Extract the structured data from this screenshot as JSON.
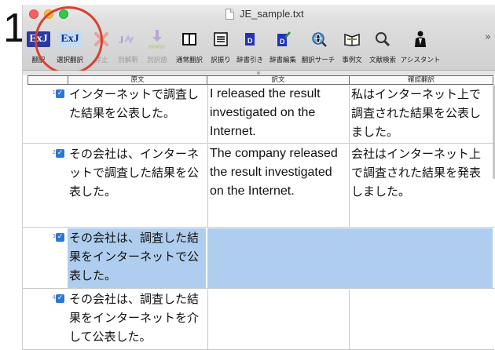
{
  "step_number": "1",
  "window": {
    "title": "JE_sample.txt"
  },
  "toolbar": {
    "items": [
      {
        "label": "翻訳",
        "icon": "exj-translate-icon"
      },
      {
        "label": "選択翻訳",
        "icon": "exj-selection-translate-icon"
      },
      {
        "label": "停止",
        "icon": "stop-x-icon"
      },
      {
        "label": "別解釈",
        "icon": "alternate-interpretation-icon"
      },
      {
        "label": "別訳語",
        "icon": "alternate-translation-word-icon"
      },
      {
        "label": "通常翻訳",
        "icon": "normal-translation-layout-icon"
      },
      {
        "label": "訳振り",
        "icon": "interlinear-translation-icon"
      },
      {
        "label": "辞書引き",
        "icon": "dictionary-lookup-icon"
      },
      {
        "label": "辞書編集",
        "icon": "dictionary-edit-icon"
      },
      {
        "label": "翻訳サーチ",
        "icon": "translation-search-icon"
      },
      {
        "label": "事例文",
        "icon": "example-sentence-icon"
      },
      {
        "label": "文献検索",
        "icon": "literature-search-icon"
      },
      {
        "label": "アシスタント",
        "icon": "assistant-icon"
      }
    ],
    "more": "»"
  },
  "columns": {
    "source": "原文",
    "translation": "訳文",
    "confirm": "確認翻訳"
  },
  "rows": [
    {
      "num": "1",
      "source": "インターネットで調査した結果を公表した。",
      "translation": "I released the result investigated on the Internet.",
      "confirm": "私はインターネット上で調査された結果を公表しました。"
    },
    {
      "num": "2",
      "source": "その会社は、インターネットで調査した結果を公表した。",
      "translation": "The company released the result investigated on the Internet.",
      "confirm": "会社はインターネット上で調査された結果を発表しました。"
    },
    {
      "num": "3",
      "source": "その会社は、調査した結果をインターネットで公表した。",
      "translation": "",
      "confirm": ""
    },
    {
      "num": "4",
      "source": "その会社は、調査した結果をインターネットを介して公表した。",
      "translation": "",
      "confirm": ""
    }
  ],
  "colors": {
    "selected_row": "#afcdee",
    "highlight_ring": "#d9412e",
    "accent": "#2a3aa0"
  }
}
